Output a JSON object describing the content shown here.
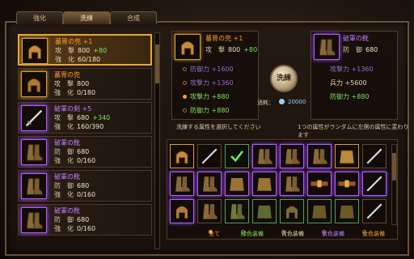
{
  "tabs": [
    {
      "label": "強化",
      "active": false
    },
    {
      "label": "洗練",
      "active": true
    },
    {
      "label": "合成",
      "active": false
    }
  ],
  "left_list": [
    {
      "name": "蕃冑の兜 +1",
      "color": "orange",
      "selected": true,
      "lines": [
        {
          "k": "攻　撃",
          "v": "800",
          "p": "+80"
        },
        {
          "k": "強　化",
          "v": "60/180",
          "p": ""
        }
      ]
    },
    {
      "name": "蕃冑の兜",
      "color": "orange",
      "selected": false,
      "lines": [
        {
          "k": "攻　撃",
          "v": "800",
          "p": ""
        },
        {
          "k": "強　化",
          "v": "0/180",
          "p": ""
        }
      ]
    },
    {
      "name": "破軍の剣 +5",
      "color": "purple",
      "selected": false,
      "lines": [
        {
          "k": "攻　撃",
          "v": "680",
          "p": "+340"
        },
        {
          "k": "強　化",
          "v": "160/390",
          "p": ""
        }
      ]
    },
    {
      "name": "破軍の靴",
      "color": "purple",
      "selected": false,
      "lines": [
        {
          "k": "防　御",
          "v": "680",
          "p": ""
        },
        {
          "k": "強　化",
          "v": "0/160",
          "p": ""
        }
      ]
    },
    {
      "name": "破軍の靴",
      "color": "purple",
      "selected": false,
      "lines": [
        {
          "k": "防　御",
          "v": "680",
          "p": ""
        },
        {
          "k": "強　化",
          "v": "0/160",
          "p": ""
        }
      ]
    },
    {
      "name": "破軍の靴",
      "color": "purple",
      "selected": false,
      "lines": [
        {
          "k": "防　御",
          "v": "680",
          "p": ""
        },
        {
          "k": "強　化",
          "v": "0/160",
          "p": ""
        }
      ]
    }
  ],
  "target": {
    "name": "蕃冑の兜 +1",
    "stat_label": "攻　撃",
    "stat_value": "800",
    "stat_plus": "+80",
    "options": [
      {
        "label": "防御力 +1600",
        "on": false
      },
      {
        "label": "攻撃力 +1360",
        "on": false
      },
      {
        "label": "攻撃力 +880",
        "on": true
      },
      {
        "label": "防御力 +880",
        "on": false
      }
    ],
    "hint": "洗練する属性を選択してください"
  },
  "source": {
    "name": "破軍の靴",
    "stat_label": "防　御",
    "stat_value": "680",
    "options": [
      {
        "label": "攻撃力 +1360",
        "on": false
      },
      {
        "label": "兵力 +5600",
        "on": false
      },
      {
        "label": "防御力 +880",
        "on": true
      }
    ],
    "hint": "1つの属性がランダムに左側の属性に変わります"
  },
  "refine_button": "洗練",
  "cost": {
    "label": "消耗：",
    "value": "20000"
  },
  "filters": [
    "全て",
    "緑色装備",
    "青色装備",
    "紫色装備",
    "金色装備"
  ],
  "colors": {
    "gold": "#e7a832",
    "purple": "#a34cff",
    "green": "#7fe05a",
    "orange": "#ff9b2b"
  }
}
